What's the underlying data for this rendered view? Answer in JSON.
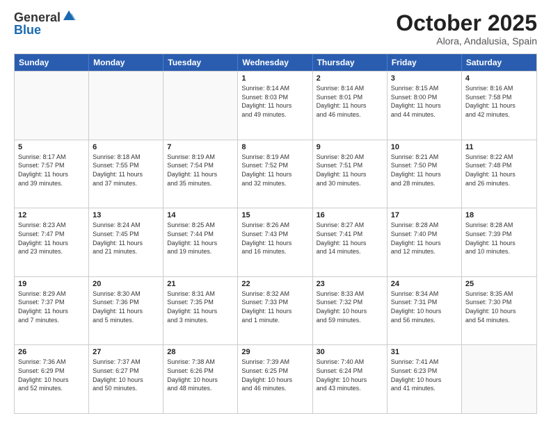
{
  "logo": {
    "general": "General",
    "blue": "Blue"
  },
  "title": {
    "month": "October 2025",
    "location": "Alora, Andalusia, Spain"
  },
  "weekdays": [
    "Sunday",
    "Monday",
    "Tuesday",
    "Wednesday",
    "Thursday",
    "Friday",
    "Saturday"
  ],
  "rows": [
    [
      {
        "day": "",
        "info": ""
      },
      {
        "day": "",
        "info": ""
      },
      {
        "day": "",
        "info": ""
      },
      {
        "day": "1",
        "info": "Sunrise: 8:14 AM\nSunset: 8:03 PM\nDaylight: 11 hours\nand 49 minutes."
      },
      {
        "day": "2",
        "info": "Sunrise: 8:14 AM\nSunset: 8:01 PM\nDaylight: 11 hours\nand 46 minutes."
      },
      {
        "day": "3",
        "info": "Sunrise: 8:15 AM\nSunset: 8:00 PM\nDaylight: 11 hours\nand 44 minutes."
      },
      {
        "day": "4",
        "info": "Sunrise: 8:16 AM\nSunset: 7:58 PM\nDaylight: 11 hours\nand 42 minutes."
      }
    ],
    [
      {
        "day": "5",
        "info": "Sunrise: 8:17 AM\nSunset: 7:57 PM\nDaylight: 11 hours\nand 39 minutes."
      },
      {
        "day": "6",
        "info": "Sunrise: 8:18 AM\nSunset: 7:55 PM\nDaylight: 11 hours\nand 37 minutes."
      },
      {
        "day": "7",
        "info": "Sunrise: 8:19 AM\nSunset: 7:54 PM\nDaylight: 11 hours\nand 35 minutes."
      },
      {
        "day": "8",
        "info": "Sunrise: 8:19 AM\nSunset: 7:52 PM\nDaylight: 11 hours\nand 32 minutes."
      },
      {
        "day": "9",
        "info": "Sunrise: 8:20 AM\nSunset: 7:51 PM\nDaylight: 11 hours\nand 30 minutes."
      },
      {
        "day": "10",
        "info": "Sunrise: 8:21 AM\nSunset: 7:50 PM\nDaylight: 11 hours\nand 28 minutes."
      },
      {
        "day": "11",
        "info": "Sunrise: 8:22 AM\nSunset: 7:48 PM\nDaylight: 11 hours\nand 26 minutes."
      }
    ],
    [
      {
        "day": "12",
        "info": "Sunrise: 8:23 AM\nSunset: 7:47 PM\nDaylight: 11 hours\nand 23 minutes."
      },
      {
        "day": "13",
        "info": "Sunrise: 8:24 AM\nSunset: 7:45 PM\nDaylight: 11 hours\nand 21 minutes."
      },
      {
        "day": "14",
        "info": "Sunrise: 8:25 AM\nSunset: 7:44 PM\nDaylight: 11 hours\nand 19 minutes."
      },
      {
        "day": "15",
        "info": "Sunrise: 8:26 AM\nSunset: 7:43 PM\nDaylight: 11 hours\nand 16 minutes."
      },
      {
        "day": "16",
        "info": "Sunrise: 8:27 AM\nSunset: 7:41 PM\nDaylight: 11 hours\nand 14 minutes."
      },
      {
        "day": "17",
        "info": "Sunrise: 8:28 AM\nSunset: 7:40 PM\nDaylight: 11 hours\nand 12 minutes."
      },
      {
        "day": "18",
        "info": "Sunrise: 8:28 AM\nSunset: 7:39 PM\nDaylight: 11 hours\nand 10 minutes."
      }
    ],
    [
      {
        "day": "19",
        "info": "Sunrise: 8:29 AM\nSunset: 7:37 PM\nDaylight: 11 hours\nand 7 minutes."
      },
      {
        "day": "20",
        "info": "Sunrise: 8:30 AM\nSunset: 7:36 PM\nDaylight: 11 hours\nand 5 minutes."
      },
      {
        "day": "21",
        "info": "Sunrise: 8:31 AM\nSunset: 7:35 PM\nDaylight: 11 hours\nand 3 minutes."
      },
      {
        "day": "22",
        "info": "Sunrise: 8:32 AM\nSunset: 7:33 PM\nDaylight: 11 hours\nand 1 minute."
      },
      {
        "day": "23",
        "info": "Sunrise: 8:33 AM\nSunset: 7:32 PM\nDaylight: 10 hours\nand 59 minutes."
      },
      {
        "day": "24",
        "info": "Sunrise: 8:34 AM\nSunset: 7:31 PM\nDaylight: 10 hours\nand 56 minutes."
      },
      {
        "day": "25",
        "info": "Sunrise: 8:35 AM\nSunset: 7:30 PM\nDaylight: 10 hours\nand 54 minutes."
      }
    ],
    [
      {
        "day": "26",
        "info": "Sunrise: 7:36 AM\nSunset: 6:29 PM\nDaylight: 10 hours\nand 52 minutes."
      },
      {
        "day": "27",
        "info": "Sunrise: 7:37 AM\nSunset: 6:27 PM\nDaylight: 10 hours\nand 50 minutes."
      },
      {
        "day": "28",
        "info": "Sunrise: 7:38 AM\nSunset: 6:26 PM\nDaylight: 10 hours\nand 48 minutes."
      },
      {
        "day": "29",
        "info": "Sunrise: 7:39 AM\nSunset: 6:25 PM\nDaylight: 10 hours\nand 46 minutes."
      },
      {
        "day": "30",
        "info": "Sunrise: 7:40 AM\nSunset: 6:24 PM\nDaylight: 10 hours\nand 43 minutes."
      },
      {
        "day": "31",
        "info": "Sunrise: 7:41 AM\nSunset: 6:23 PM\nDaylight: 10 hours\nand 41 minutes."
      },
      {
        "day": "",
        "info": ""
      }
    ]
  ]
}
